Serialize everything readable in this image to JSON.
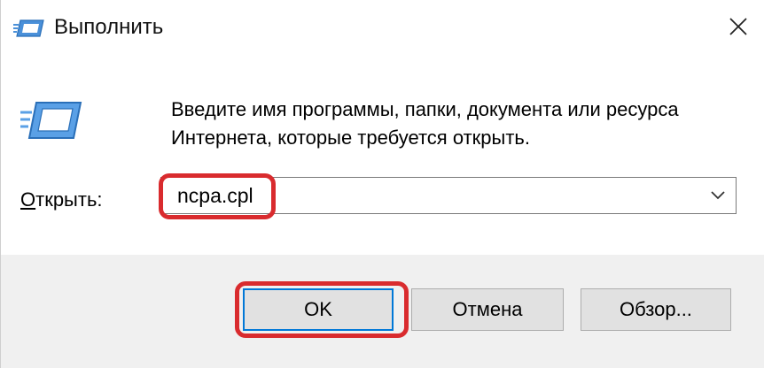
{
  "window": {
    "title": "Выполнить",
    "icon": "run-icon",
    "close_icon": "close-icon"
  },
  "dialog": {
    "description": "Введите имя программы, папки, документа или ресурса Интернета, которые требуется открыть.",
    "open_label": "Открыть:",
    "open_label_accel": "О",
    "open_label_rest": "ткрыть:",
    "input_value": "ncpa.cpl",
    "dropdown_icon": "chevron-down-icon"
  },
  "buttons": {
    "ok": "OK",
    "cancel": "Отмена",
    "browse": "Обзор..."
  },
  "highlights": {
    "color": "#d92b2e",
    "targets": [
      "open-combobox-value",
      "ok-button"
    ]
  },
  "colors": {
    "default_button_border": "#0078d7",
    "button_face": "#e1e1e1",
    "dialog_bg": "#f0f0f0"
  }
}
